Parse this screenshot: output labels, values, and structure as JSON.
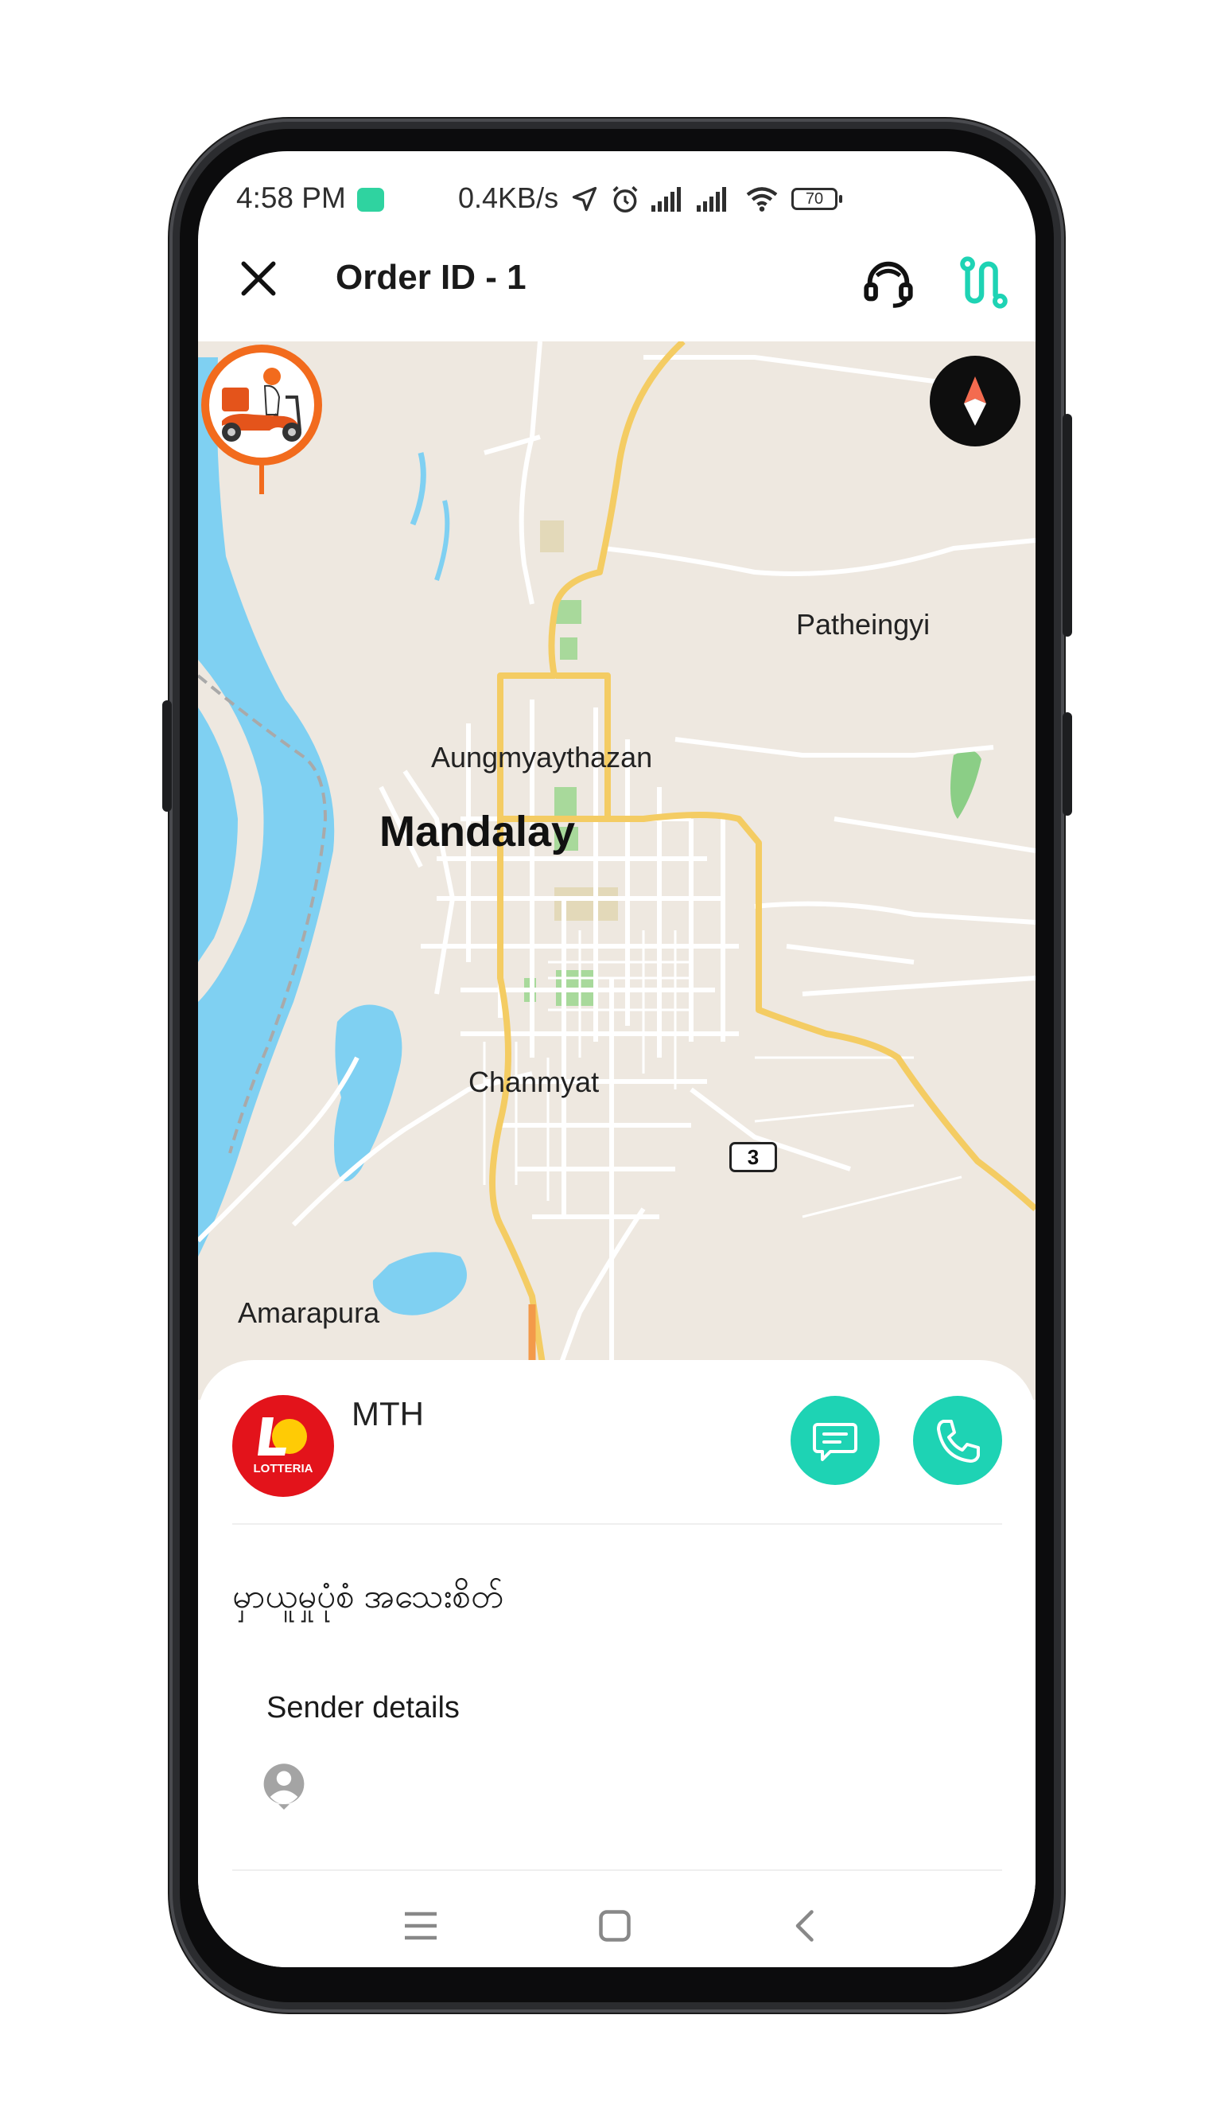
{
  "status_bar": {
    "time": "4:58 PM",
    "network_speed": "0.4KB/s",
    "battery_level": "70",
    "icons": [
      "app-notification-icon",
      "location-arrow-icon",
      "alarm-icon",
      "signal-icon",
      "signal-icon",
      "wifi-icon",
      "battery-icon"
    ]
  },
  "header": {
    "title": "Order ID - 1",
    "close_icon": "close-icon",
    "support_icon": "headset-icon",
    "route_icon": "route-icon"
  },
  "map": {
    "labels": {
      "patheingyi": "Patheingyi",
      "aungmyaythazan": "Aungmyaythazan",
      "mandalay": "Mandalay",
      "chanmyat": "Chanmyat",
      "amarapura": "Amarapura"
    },
    "road_badge": "3",
    "compass_icon": "compass-icon",
    "rider_icon": "delivery-scooter-icon",
    "colors": {
      "land": "#eee8e0",
      "water": "#7fd0f2",
      "major_road": "#f4cc63",
      "road": "#ffffff",
      "park": "#a8d99b",
      "route_highlight": "#f39a4a"
    }
  },
  "order": {
    "store_name": "MTH",
    "store_logo_text": "LOTTERIA",
    "store_logo_mark": "LO",
    "status": "မှာယူမှုပုံစံ အသေးစိတ်",
    "chat_icon": "chat-icon",
    "call_icon": "phone-icon",
    "sender_details_label": "Sender details",
    "sender_avatar_icon": "user-avatar-icon",
    "accent_color": "#1ed3b4"
  },
  "nav_bar": {
    "items": [
      "menu-icon",
      "home-square-icon",
      "back-chevron-icon"
    ]
  }
}
